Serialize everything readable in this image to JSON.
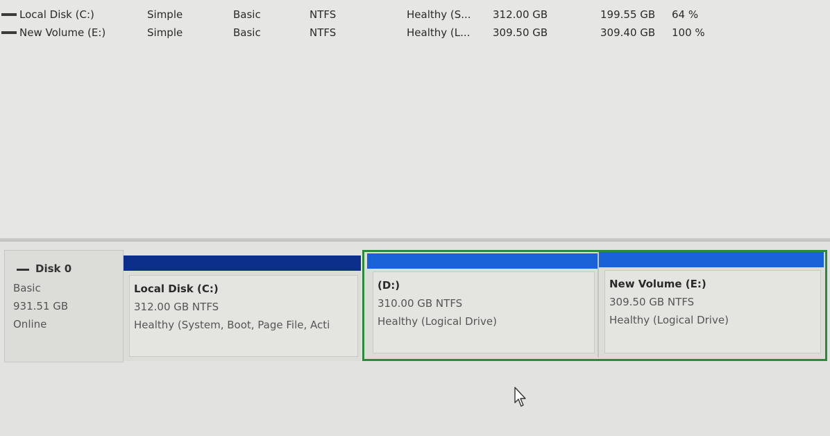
{
  "volume_list": {
    "rows": [
      {
        "volume": "Local Disk (C:)",
        "layout": "Simple",
        "type": "Basic",
        "file_system": "NTFS",
        "status": "Healthy (S...",
        "capacity": "312.00 GB",
        "free_space": "199.55 GB",
        "percent_free": "64 %"
      },
      {
        "volume": "New Volume (E:)",
        "layout": "Simple",
        "type": "Basic",
        "file_system": "NTFS",
        "status": "Healthy (L...",
        "capacity": "309.50 GB",
        "free_space": "309.40 GB",
        "percent_free": "100 %"
      }
    ]
  },
  "disk": {
    "name": "Disk 0",
    "type": "Basic",
    "size": "931.51 GB",
    "status": "Online"
  },
  "partitions": [
    {
      "name": "Local Disk  (C:)",
      "size": "312.00 GB NTFS",
      "status": "Healthy (System, Boot, Page File, Acti",
      "bar_color": "#0c2f8c"
    },
    {
      "name": "(D:)",
      "size": "310.00 GB NTFS",
      "status": "Healthy (Logical Drive)",
      "bar_color": "#1a62d8"
    },
    {
      "name": "New Volume  (E:)",
      "size": "309.50 GB NTFS",
      "status": "Healthy (Logical Drive)",
      "bar_color": "#1a62d8"
    }
  ],
  "colors": {
    "primary_partition": "#0c2f8c",
    "logical_drive": "#1a62d8",
    "extended_partition_border": "#2a8a3a"
  },
  "icons": {
    "volume_icon": "drive-icon",
    "disk_icon": "disk-collapse-icon",
    "cursor": "mouse-pointer-icon"
  }
}
